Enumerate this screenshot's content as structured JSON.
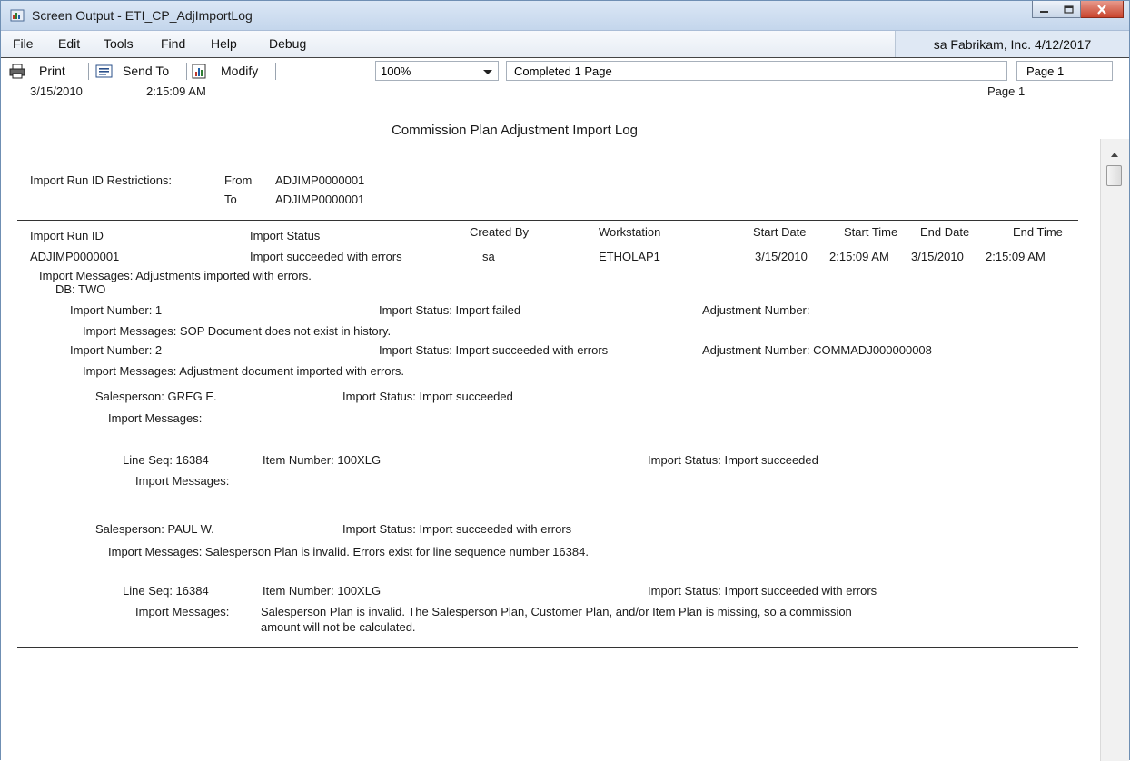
{
  "window": {
    "title": "Screen Output - ETI_CP_AdjImportLog",
    "app_icon": "report-window-icon",
    "buttons": [
      "minimize-icon",
      "maximize-icon",
      "close-icon"
    ]
  },
  "menu": {
    "items": [
      "File",
      "Edit",
      "Tools",
      "Find",
      "Help",
      "Debug"
    ],
    "user_info": "sa  Fabrikam, Inc. 4/12/2017"
  },
  "toolbar": {
    "print_label": "Print",
    "print_icon": "printer-icon",
    "send_to_label": "Send To",
    "send_to_icon": "send-document-icon",
    "modify_label": "Modify",
    "modify_icon": "modify-report-icon",
    "zoom_value": "100%",
    "status_text": "Completed 1 Page",
    "page_indicator": "Page 1"
  },
  "report": {
    "date": "3/15/2010",
    "time": "2:15:09 AM",
    "page": "Page 1",
    "title": "Commission Plan Adjustment Import Log",
    "restrictions_label": "Import Run ID Restrictions:",
    "from_label": "From",
    "from_value": "ADJIMP0000001",
    "to_label": "To",
    "to_value": "ADJIMP0000001",
    "columns": [
      "Import Run ID",
      "Import Status",
      "Created By",
      "Workstation",
      "Start Date",
      "Start Time",
      "End Date",
      "End Time"
    ],
    "run_row": [
      "ADJIMP0000001",
      "Import succeeded with errors",
      "sa",
      "ETHOLAP1",
      "3/15/2010",
      "2:15:09 AM",
      "3/15/2010",
      "2:15:09 AM"
    ],
    "run_messages": "Import Messages:  Adjustments imported with errors.",
    "db": "DB:  TWO",
    "import1": {
      "number": "Import Number:  1",
      "status": "Import Status:  Import failed",
      "adjustment": "Adjustment Number:",
      "messages": "Import Messages:  SOP Document does not exist in history."
    },
    "import2": {
      "number": "Import Number:  2",
      "status": "Import Status:  Import succeeded with errors",
      "adjustment": "Adjustment Number: COMMADJ000000008",
      "messages": "Import Messages:  Adjustment document imported with errors."
    },
    "sp1": {
      "salesperson": "Salesperson: GREG E.",
      "status": "Import Status:  Import succeeded",
      "messages": "Import Messages:",
      "line_seq": "Line Seq:  16384",
      "item": "Item Number:  100XLG",
      "line_status": "Import Status:  Import succeeded",
      "line_messages": "Import Messages:"
    },
    "sp2": {
      "salesperson": "Salesperson: PAUL W.",
      "status": "Import Status:  Import succeeded with errors",
      "messages": "Import Messages:  Salesperson Plan is invalid. Errors exist for line sequence number 16384.",
      "line_seq": "Line Seq:  16384",
      "item": "Item Number:  100XLG",
      "line_status": "Import Status:  Import succeeded with errors",
      "line_messages_label": "Import Messages:",
      "line_messages_1": "Salesperson Plan is invalid. The Salesperson Plan, Customer Plan, and/or Item Plan is missing, so a commission",
      "line_messages_2": "amount will not be calculated."
    }
  }
}
